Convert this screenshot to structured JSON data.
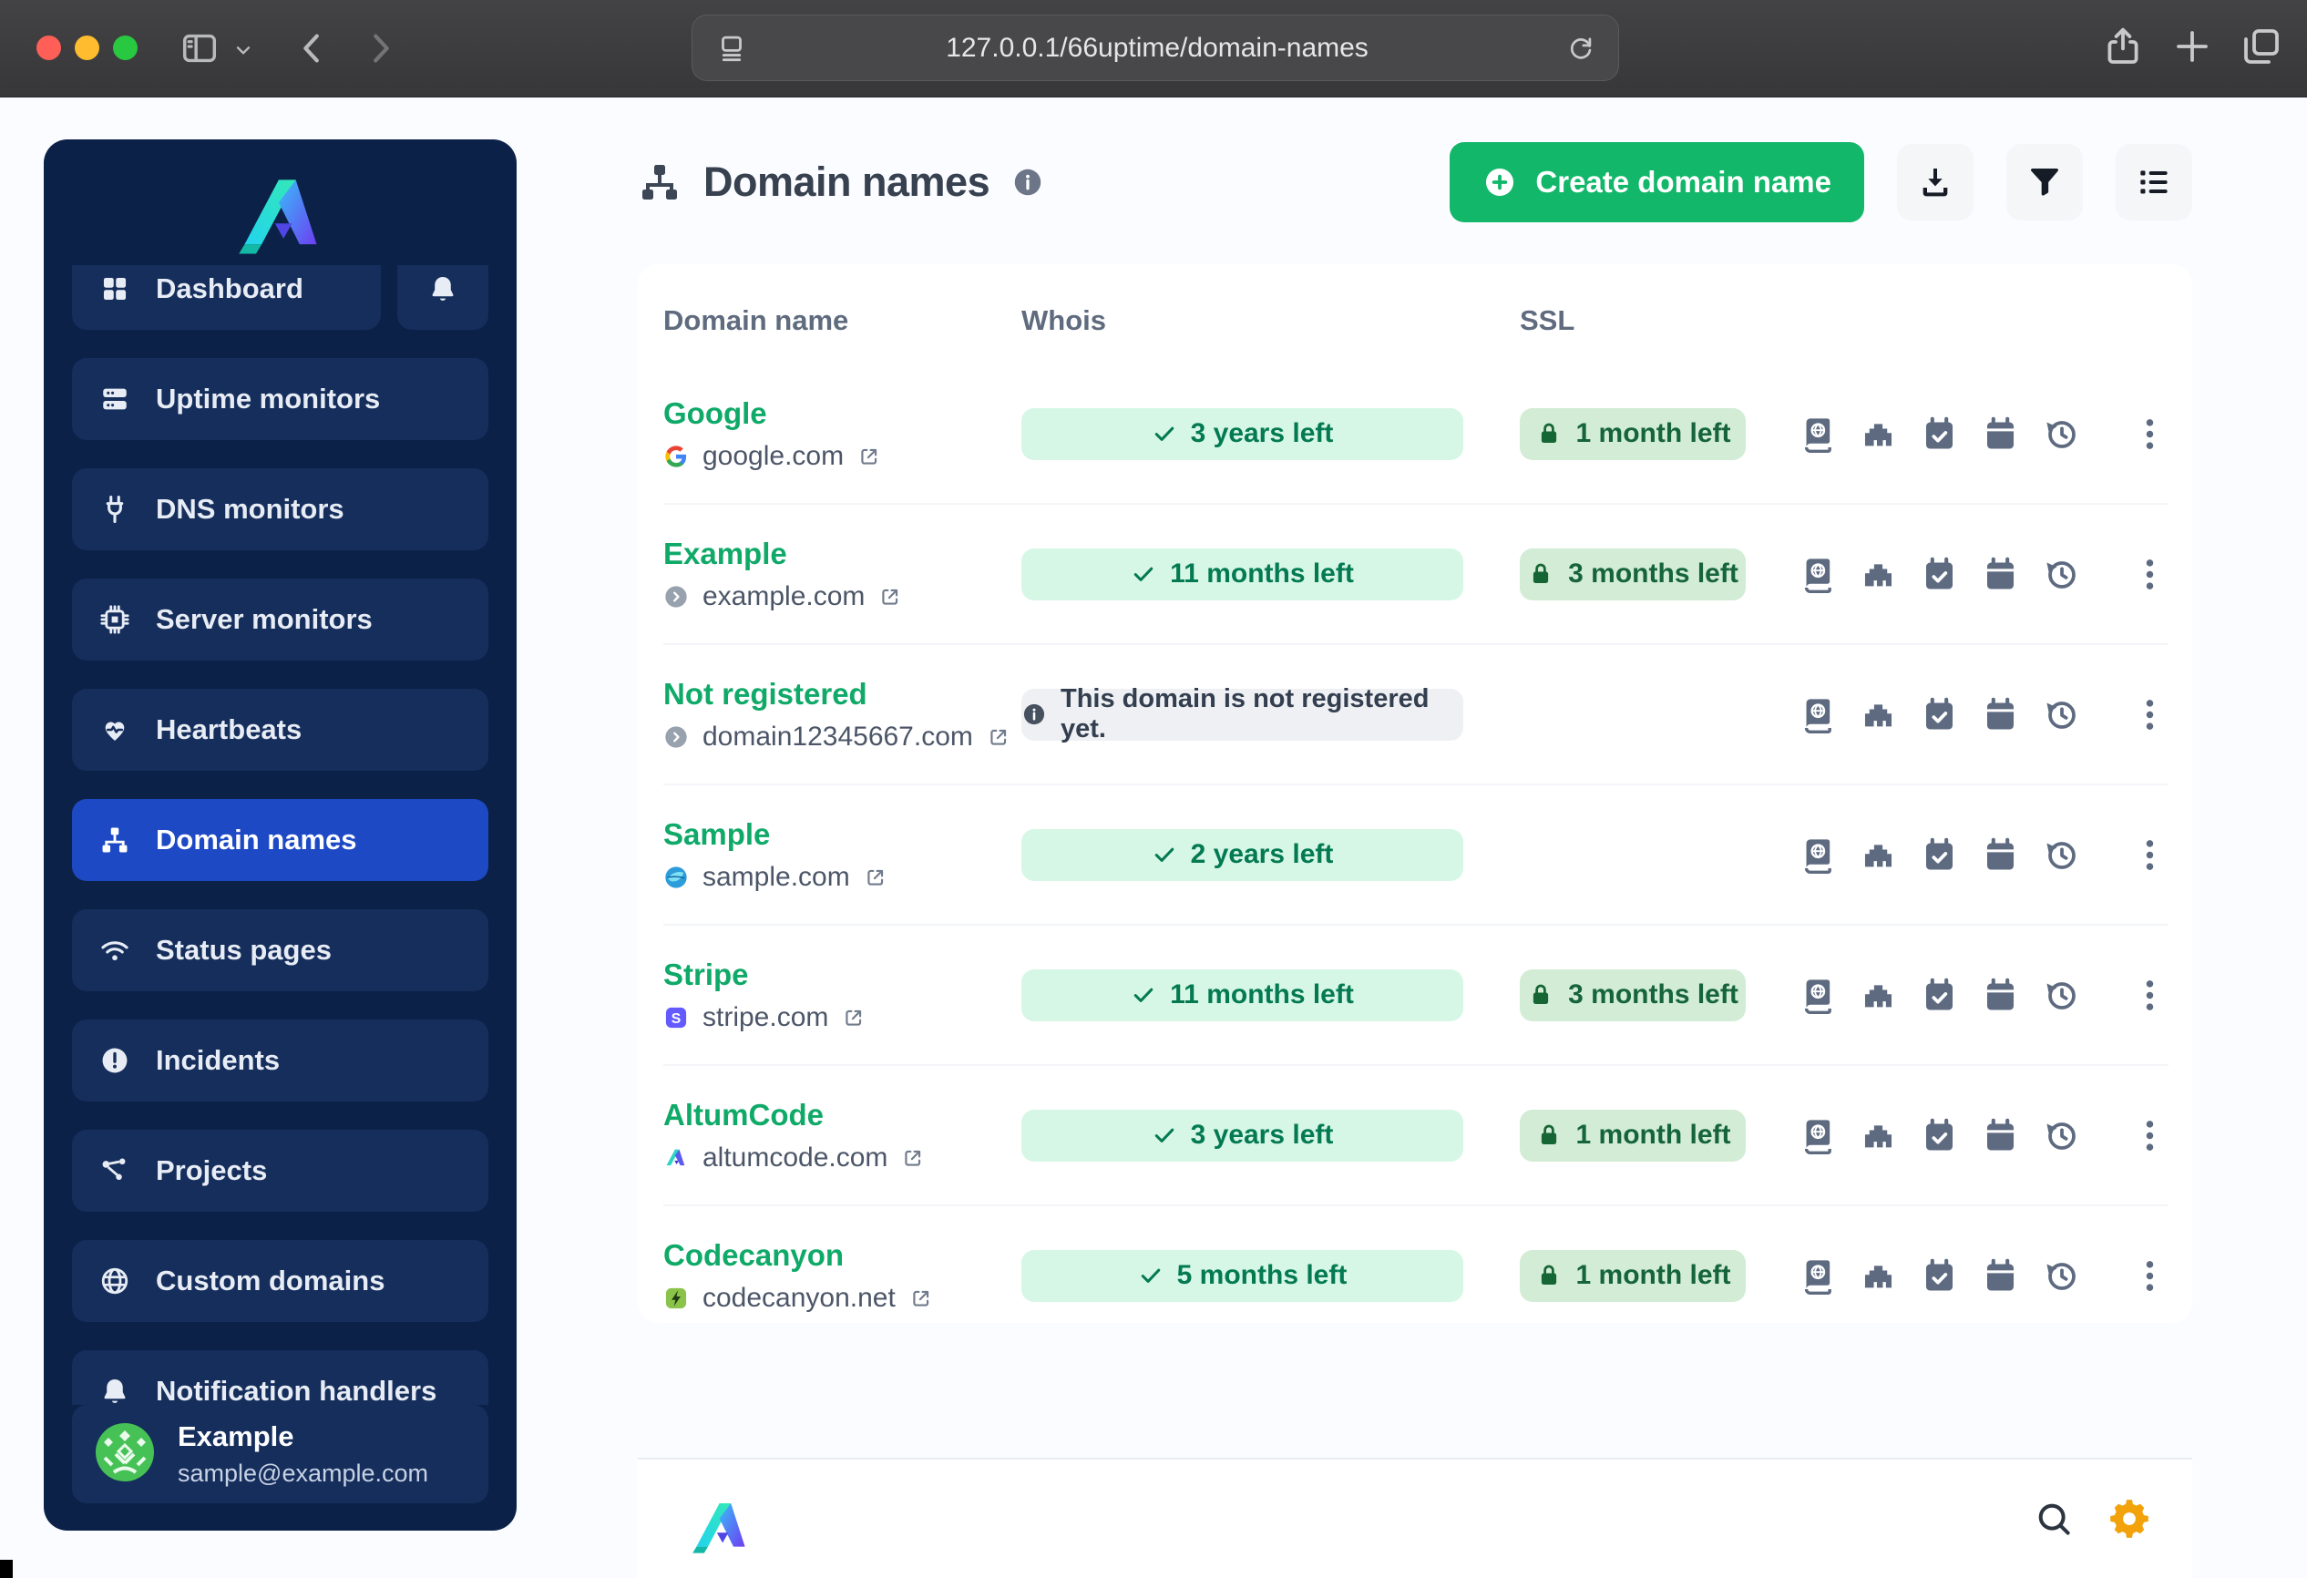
{
  "browser": {
    "url": "127.0.0.1/66uptime/domain-names",
    "traffic_lights": [
      "#ff5f57",
      "#febc2e",
      "#28c840"
    ],
    "icons": [
      "sidebar-toggle",
      "chevron-down",
      "back",
      "forward",
      "reader",
      "reload",
      "share",
      "new-tab",
      "tabs"
    ]
  },
  "sidebar": {
    "items": [
      {
        "label": "Dashboard",
        "icon": "grid",
        "active": false,
        "has_bell": true
      },
      {
        "label": "Uptime monitors",
        "icon": "uptime",
        "active": false
      },
      {
        "label": "DNS monitors",
        "icon": "plug",
        "active": false
      },
      {
        "label": "Server monitors",
        "icon": "chip",
        "active": false
      },
      {
        "label": "Heartbeats",
        "icon": "heartbeat",
        "active": false
      },
      {
        "label": "Domain names",
        "icon": "sitemap",
        "active": true
      },
      {
        "label": "Status pages",
        "icon": "wifi",
        "active": false
      },
      {
        "label": "Incidents",
        "icon": "alert",
        "active": false
      },
      {
        "label": "Projects",
        "icon": "nodes",
        "active": false
      },
      {
        "label": "Custom domains",
        "icon": "globe",
        "active": false
      },
      {
        "label": "Notification handlers",
        "icon": "bell",
        "active": false
      }
    ],
    "user": {
      "name": "Example",
      "email": "sample@example.com"
    }
  },
  "header": {
    "title": "Domain names",
    "title_icon": "sitemap",
    "info_icon": "info",
    "create_label": "Create domain name",
    "tool_buttons": [
      "download",
      "filter",
      "list"
    ]
  },
  "table": {
    "columns": [
      "Domain name",
      "Whois",
      "SSL"
    ],
    "row_actions": [
      "whois-book",
      "ethernet",
      "calendar-check",
      "calendar",
      "history"
    ],
    "rows": [
      {
        "name": "Google",
        "domain": "google.com",
        "favicon": "google",
        "whois": {
          "type": "ok",
          "text": "3 years left"
        },
        "ssl": {
          "present": true,
          "text": "1 month left"
        }
      },
      {
        "name": "Example",
        "domain": "example.com",
        "favicon": "default",
        "whois": {
          "type": "ok",
          "text": "11 months left"
        },
        "ssl": {
          "present": true,
          "text": "3 months left"
        }
      },
      {
        "name": "Not registered",
        "domain": "domain12345667.com",
        "favicon": "default",
        "whois": {
          "type": "info",
          "text": "This domain is not registered yet."
        },
        "ssl": {
          "present": false,
          "text": ""
        }
      },
      {
        "name": "Sample",
        "domain": "sample.com",
        "favicon": "sample",
        "whois": {
          "type": "ok",
          "text": "2 years left"
        },
        "ssl": {
          "present": false,
          "text": ""
        }
      },
      {
        "name": "Stripe",
        "domain": "stripe.com",
        "favicon": "stripe",
        "whois": {
          "type": "ok",
          "text": "11 months left"
        },
        "ssl": {
          "present": true,
          "text": "3 months left"
        }
      },
      {
        "name": "AltumCode",
        "domain": "altumcode.com",
        "favicon": "altumcode",
        "whois": {
          "type": "ok",
          "text": "3 years left"
        },
        "ssl": {
          "present": true,
          "text": "1 month left"
        }
      },
      {
        "name": "Codecanyon",
        "domain": "codecanyon.net",
        "favicon": "codecanyon",
        "whois": {
          "type": "ok",
          "text": "5 months left"
        },
        "ssl": {
          "present": true,
          "text": "1 month left"
        }
      }
    ]
  },
  "footer": {
    "icons": [
      "search",
      "gear"
    ]
  },
  "colors": {
    "accent_green": "#12b76a",
    "link_green": "#0fa968",
    "sidebar_bg": "#0c2148",
    "sidebar_item_bg": "#152e5c",
    "sidebar_active_bg": "#1d49c4",
    "whois_badge_bg": "#d6f7e6",
    "whois_badge_text": "#047a52",
    "ssl_badge_bg": "#d2ecd5",
    "ssl_badge_text": "#15643a",
    "gear_orange": "#f2a30b"
  }
}
